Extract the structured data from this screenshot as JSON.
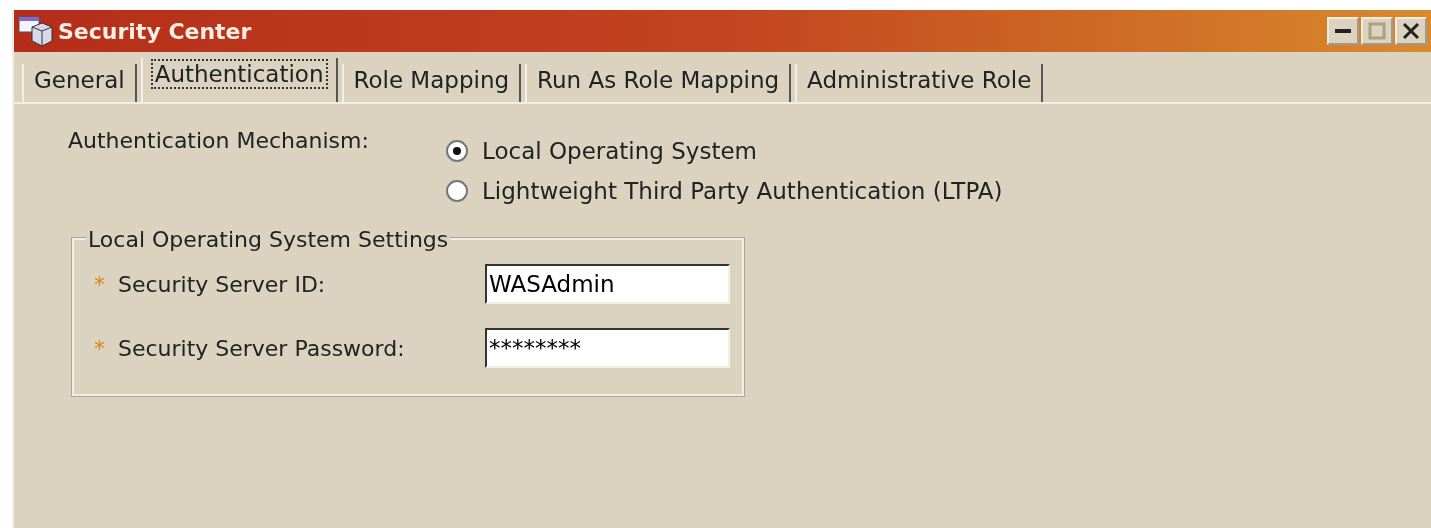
{
  "window": {
    "title": "Security Center"
  },
  "tabs": [
    {
      "label": "General",
      "selected": false
    },
    {
      "label": "Authentication",
      "selected": true
    },
    {
      "label": "Role Mapping",
      "selected": false
    },
    {
      "label": "Run As Role Mapping",
      "selected": false
    },
    {
      "label": "Administrative Role",
      "selected": false
    }
  ],
  "authentication_mechanism": {
    "label": "Authentication Mechanism:",
    "options": [
      {
        "label": "Local Operating System",
        "selected": true
      },
      {
        "label": "Lightweight Third Party Authentication (LTPA)",
        "selected": false
      }
    ]
  },
  "settings_group": {
    "title": "Local Operating System Settings",
    "fields": [
      {
        "marker": "*",
        "label": "Security Server ID:",
        "value": "WASAdmin"
      },
      {
        "marker": "*",
        "label": "Security Server Password:",
        "value": "********"
      }
    ]
  }
}
